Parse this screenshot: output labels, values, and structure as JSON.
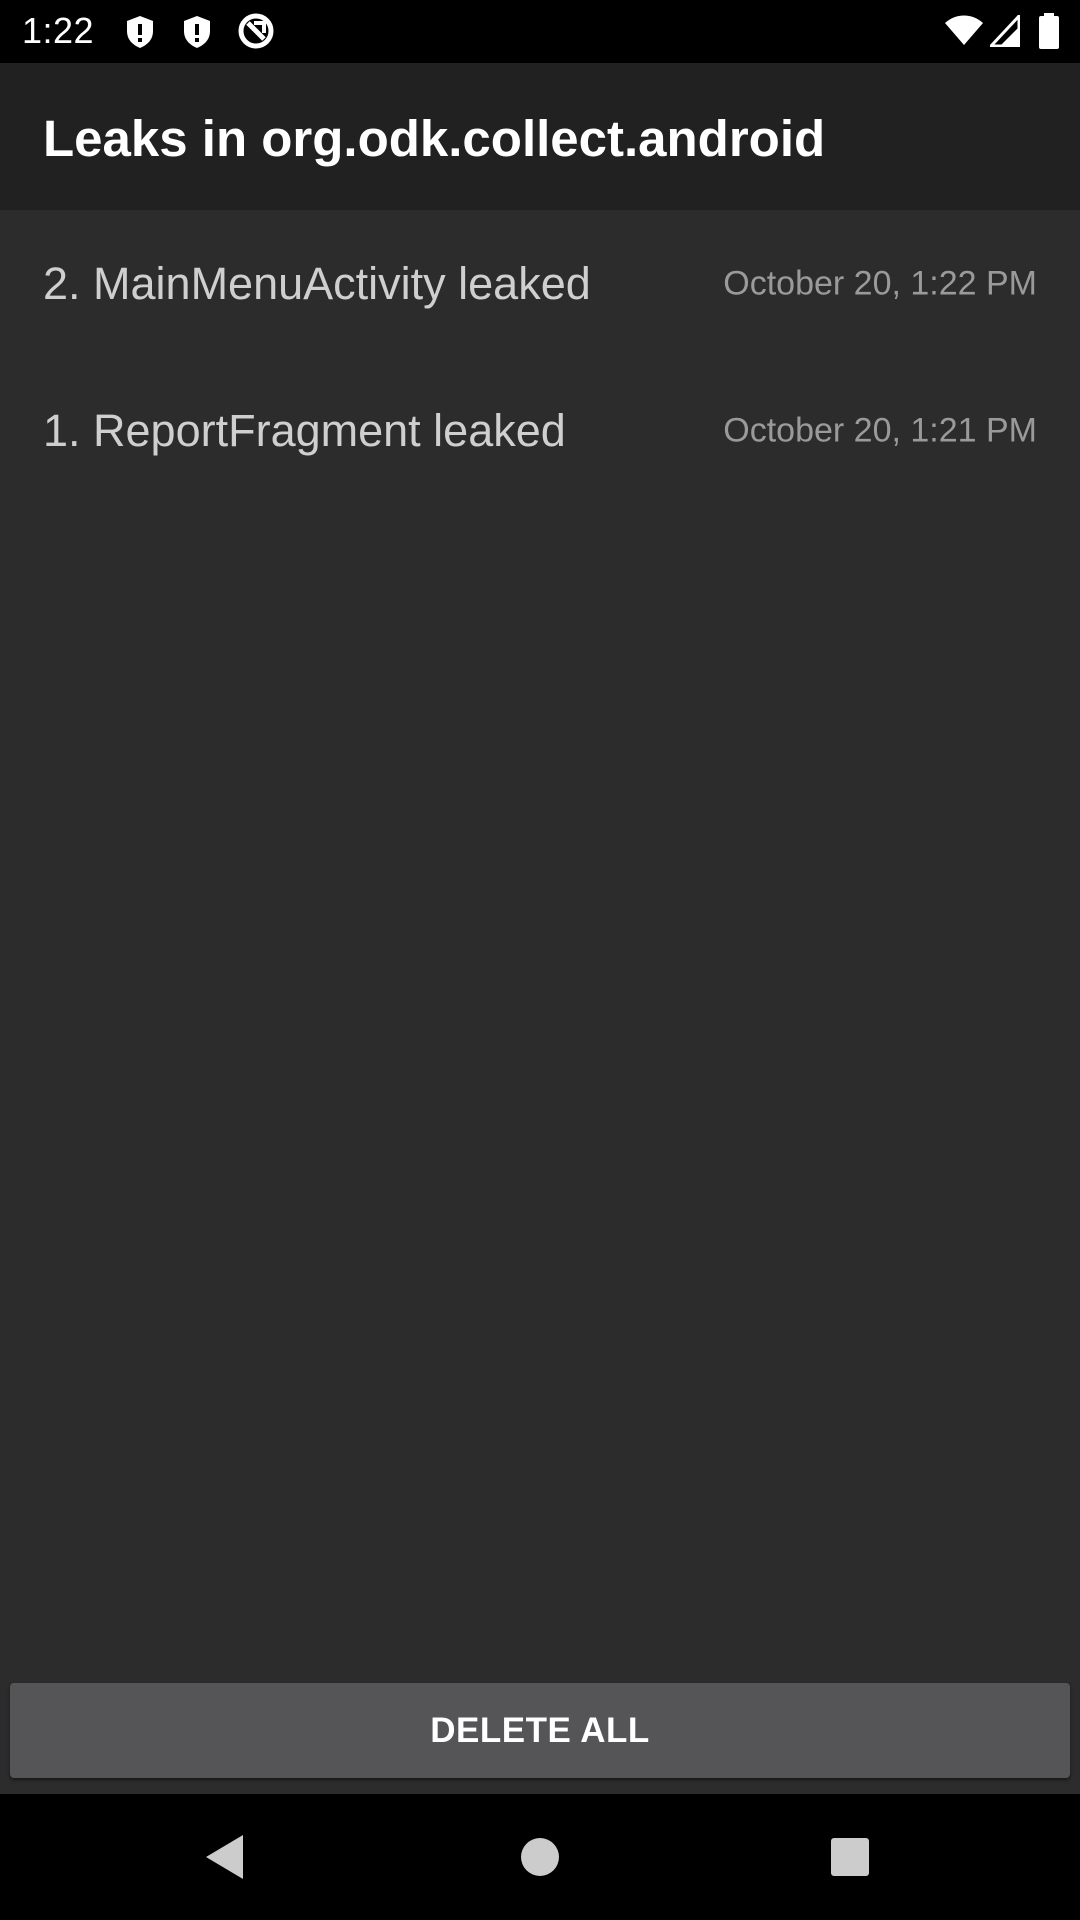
{
  "status_bar": {
    "time": "1:22",
    "icons_left": [
      "shield-icon",
      "shield-icon",
      "sync-icon"
    ],
    "icons_right": [
      "wifi-icon",
      "cellular-signal-icon",
      "battery-icon"
    ]
  },
  "app_bar": {
    "title": "Leaks in org.odk.collect.android"
  },
  "leaks": [
    {
      "title": "2. MainMenuActivity leaked",
      "time": "October 20, 1:22 PM"
    },
    {
      "title": "1. ReportFragment leaked",
      "time": "October 20, 1:21 PM"
    }
  ],
  "actions": {
    "delete_all_label": "DELETE ALL"
  },
  "nav_bar": {
    "buttons": [
      "back-icon",
      "home-icon",
      "recents-icon"
    ]
  },
  "colors": {
    "background": "#2c2c2c",
    "app_bar": "#212121",
    "button": "#555558"
  }
}
